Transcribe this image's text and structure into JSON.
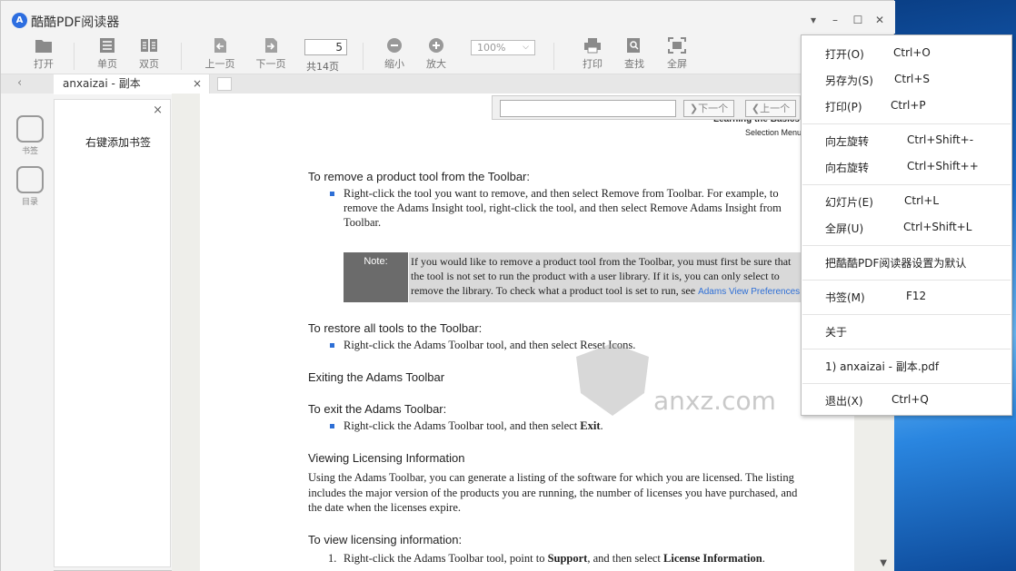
{
  "app": {
    "title": "酷酷PDF阅读器",
    "logo_letter": "A"
  },
  "window_controls": {
    "menu": "▾",
    "minimize": "–",
    "maximize": "☐",
    "close": "✕"
  },
  "toolbar": {
    "open": "打开",
    "single_page": "单页",
    "double_page": "双页",
    "prev_page": "上一页",
    "next_page": "下一页",
    "current_page": "5",
    "total_pages": "共14页",
    "zoom_out": "缩小",
    "zoom_in": "放大",
    "zoom_value": "100%",
    "print": "打印",
    "find": "查找",
    "fullscreen": "全屏"
  },
  "tabs": [
    {
      "label": "anxaizai - 副本",
      "close": "×"
    }
  ],
  "rail": {
    "bookmarks": "书签",
    "toc": "目录"
  },
  "bookmark_panel": {
    "close": "×",
    "hint": "右键添加书签"
  },
  "search": {
    "next": "下一个",
    "prev": "上一个"
  },
  "document": {
    "header_title": "Learning the Basics",
    "header_sub": "Selection Menu",
    "h1": "To remove a product tool from the Toolbar:",
    "p1": [
      "Right-click the tool you want to remove, and then select Remove from Toolbar. For example, to",
      "remove the Adams Insight tool, right-click the tool, and then select Remove Adams Insight from",
      "Toolbar."
    ],
    "note_label": "Note:",
    "note_lines": [
      "If you would like to remove a product tool from the Toolbar, you must first be sure that",
      "the tool is not set to run the product with a user library. If it is, you can only select to",
      "remove the library. To check what a product tool is set to run, see "
    ],
    "note_link": "Adams View Preferences",
    "h2": "To restore all tools to the Toolbar:",
    "p2": "Right-click the Adams Toolbar tool, and then select Reset Icons.",
    "h3": "Exiting the Adams Toolbar",
    "h4": "To exit the Adams Toolbar:",
    "p4_pre": "Right-click the Adams Toolbar tool, and then select ",
    "p4_bold": "Exit",
    "p4_post": ".",
    "h5": "Viewing Licensing Information",
    "p5": [
      "Using the Adams Toolbar, you can generate a listing of the software for which you are licensed. The listing",
      "includes the major version of the products you are running, the number of licenses you have purchased, and",
      "the date when the licenses expire."
    ],
    "h6": "To view licensing information:",
    "p6_num": "1.",
    "p6_pre": "Right-click the Adams Toolbar tool, point to ",
    "p6_b1": "Support",
    "p6_mid": ", and then select ",
    "p6_b2": "License Information",
    "p6_post": "."
  },
  "watermark": {
    "text": "anxz.com"
  },
  "menu": {
    "open": "打开(O)",
    "open_sc": "Ctrl+O",
    "save_as": "另存为(S)",
    "save_as_sc": "Ctrl+S",
    "print": "打印(P)",
    "print_sc": "Ctrl+P",
    "rotate_left": "向左旋转",
    "rotate_left_sc": "Ctrl+Shift+-",
    "rotate_right": "向右旋转",
    "rotate_right_sc": "Ctrl+Shift++",
    "slideshow": "幻灯片(E)",
    "slideshow_sc": "Ctrl+L",
    "fullscreen": "全屏(U)",
    "fullscreen_sc": "Ctrl+Shift+L",
    "set_default": "把酷酷PDF阅读器设置为默认",
    "bookmark": "书签(M)",
    "bookmark_sc": "F12",
    "about": "关于",
    "recent1": "1) anxaizai - 副本.pdf",
    "exit": "退出(X)",
    "exit_sc": "Ctrl+Q"
  }
}
